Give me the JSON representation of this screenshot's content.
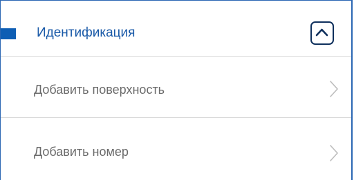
{
  "section": {
    "title": "Идентификация",
    "toggle_icon": "chevron-up-icon",
    "accent_color": "#0e5eb4",
    "expanded": true
  },
  "items": [
    {
      "label": "Добавить поверхность",
      "icon": "chevron-right-icon"
    },
    {
      "label": "Добавить номер",
      "icon": "chevron-right-icon"
    }
  ]
}
